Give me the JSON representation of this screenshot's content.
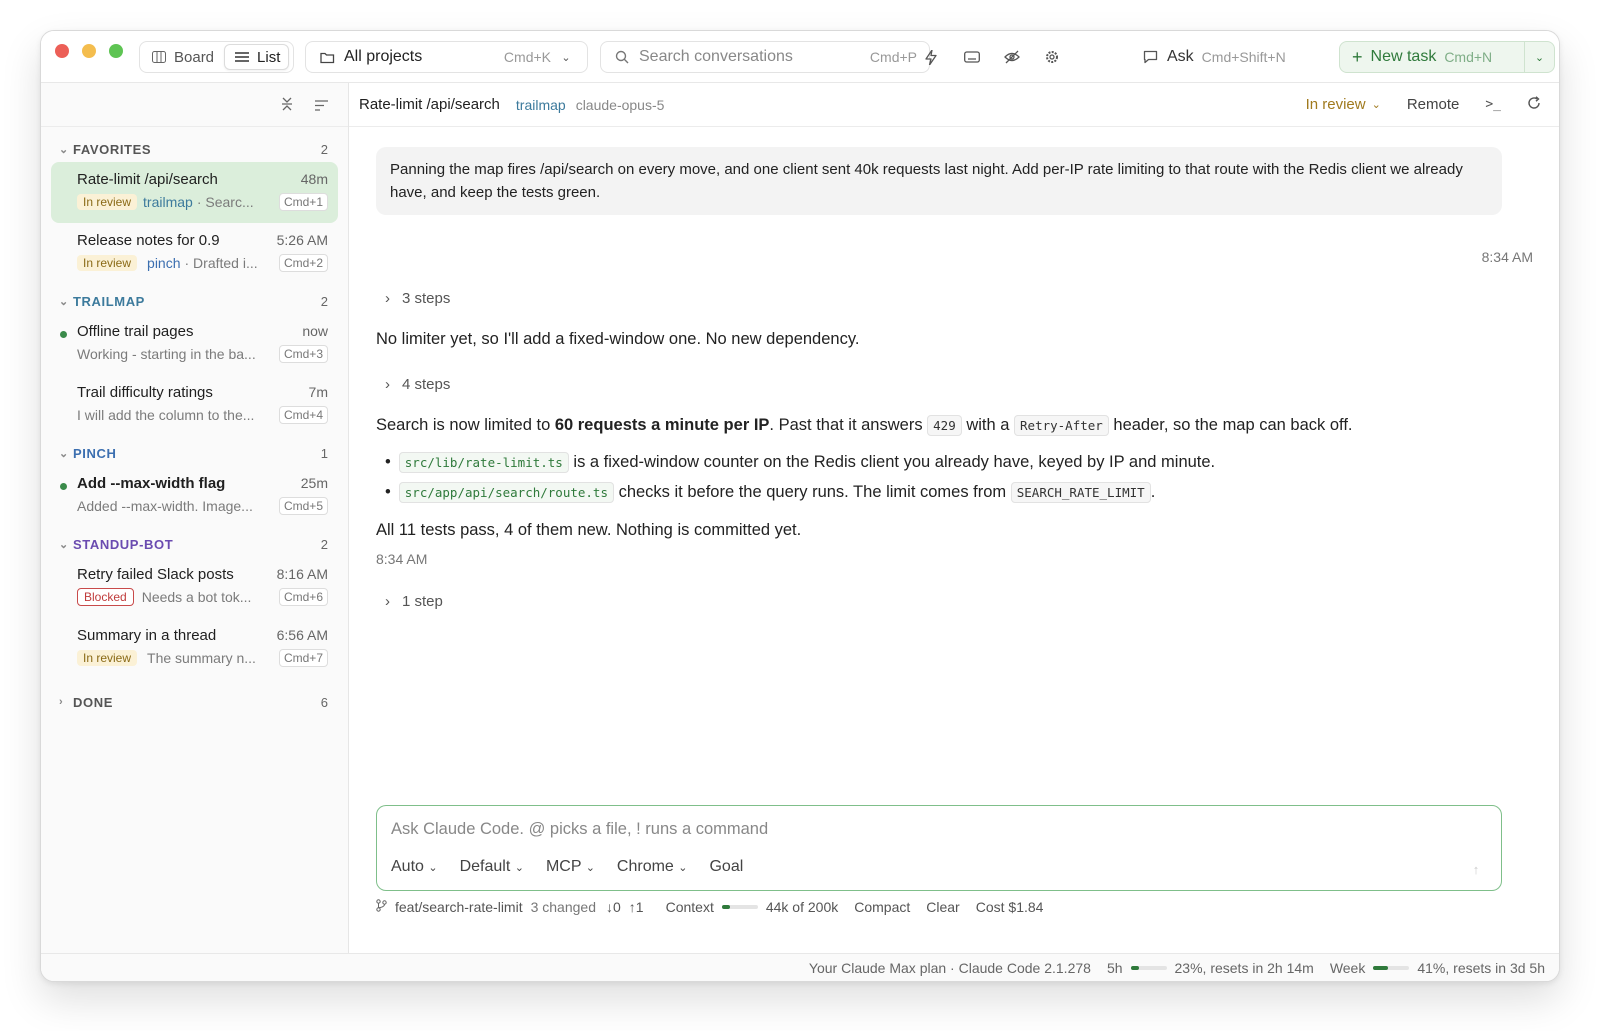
{
  "toolbar": {
    "board": "Board",
    "list": "List",
    "project": "All projects",
    "project_kbd": "Cmd+K",
    "search_placeholder": "Search conversations",
    "search_kbd": "Cmd+P",
    "ask": "Ask",
    "ask_kbd": "Cmd+Shift+N",
    "new_task": "New task",
    "new_task_kbd": "Cmd+N"
  },
  "sidebar": {
    "groups": [
      {
        "name": "FAVORITES",
        "count": "2",
        "color": "#555555",
        "items": [
          {
            "title": "Rate-limit /api/search",
            "time": "48m",
            "badge": "In review",
            "project": "trailmap",
            "preview": "· Searc...",
            "kbd": "Cmd+1",
            "selected": true
          },
          {
            "title": "Release notes for 0.9",
            "time": "5:26 AM",
            "badge": "In review",
            "project": "pinch",
            "preview": "· Drafted i...",
            "kbd": "Cmd+2"
          }
        ]
      },
      {
        "name": "TRAILMAP",
        "count": "2",
        "color": "#3c7a9c",
        "items": [
          {
            "title": "Offline trail pages",
            "time": "now",
            "preview": "Working - starting in the ba...",
            "kbd": "Cmd+3",
            "dot": true
          },
          {
            "title": "Trail difficulty ratings",
            "time": "7m",
            "preview": "I will add the column to the...",
            "kbd": "Cmd+4"
          }
        ]
      },
      {
        "name": "PINCH",
        "count": "1",
        "color": "#3c6fb0",
        "items": [
          {
            "title": "Add --max-width flag",
            "time": "25m",
            "preview": "Added --max-width. Image...",
            "kbd": "Cmd+5",
            "dot": true,
            "bold": true
          }
        ]
      },
      {
        "name": "STANDUP-BOT",
        "count": "2",
        "color": "#6a4bb0",
        "items": [
          {
            "title": "Retry failed Slack posts",
            "time": "8:16 AM",
            "badge": "Blocked",
            "preview": "Needs a bot tok...",
            "kbd": "Cmd+6"
          },
          {
            "title": "Summary in a thread",
            "time": "6:56 AM",
            "badge": "In review",
            "preview": "The summary n...",
            "kbd": "Cmd+7"
          }
        ]
      }
    ],
    "done": {
      "name": "DONE",
      "count": "6"
    }
  },
  "main": {
    "title": "Rate-limit /api/search",
    "project": "trailmap",
    "model": "claude-opus-5",
    "status": "In review",
    "remote": "Remote",
    "user_message": "Panning the map fires /api/search on every move, and one client sent 40k requests last night. Add per-IP rate limiting to that route with the Redis client we already have, and keep the tests green.",
    "user_time": "8:34 AM",
    "steps1": "3 steps",
    "reply1": "No limiter yet, so I'll add a fixed-window one. No new dependency.",
    "steps2": "4 steps",
    "reply2_a": "Search is now limited to ",
    "reply2_b": "60 requests a minute per IP",
    "reply2_c": ". Past that it answers ",
    "reply2_code1": "429",
    "reply2_d": " with a ",
    "reply2_code2": "Retry-After",
    "reply2_e": " header, so the map can back off.",
    "bullet1_code": "src/lib/rate-limit.ts",
    "bullet1_text": " is a fixed-window counter on the Redis client you already have, keyed by IP and minute.",
    "bullet2_code": "src/app/api/search/route.ts",
    "bullet2_text": " checks it before the query runs. The limit comes from ",
    "bullet2_code2": "SEARCH_RATE_LIMIT",
    "bullet2_end": ".",
    "reply3": "All 11 tests pass, 4 of them new. Nothing is committed yet.",
    "reply_time": "8:34 AM",
    "steps3": "1 step"
  },
  "composer": {
    "placeholder": "Ask Claude Code. @ picks a file, ! runs a command",
    "options": [
      "Auto",
      "Default",
      "MCP",
      "Chrome"
    ],
    "goal": "Goal"
  },
  "footer": {
    "branch": "feat/search-rate-limit",
    "changed": "3 changed",
    "down": "↓0",
    "up": "↑1",
    "context_label": "Context",
    "context_fraction": 0.22,
    "context_value": "44k of 200k",
    "compact": "Compact",
    "clear": "Clear",
    "cost": "Cost $1.84"
  },
  "status": {
    "plan": "Your Claude Max plan · Claude Code 2.1.278",
    "five_h_label": "5h",
    "five_h_fraction": 0.23,
    "five_h_text": "23%, resets in 2h 14m",
    "week_label": "Week",
    "week_fraction": 0.41,
    "week_text": "41%, resets in 3d 5h"
  }
}
